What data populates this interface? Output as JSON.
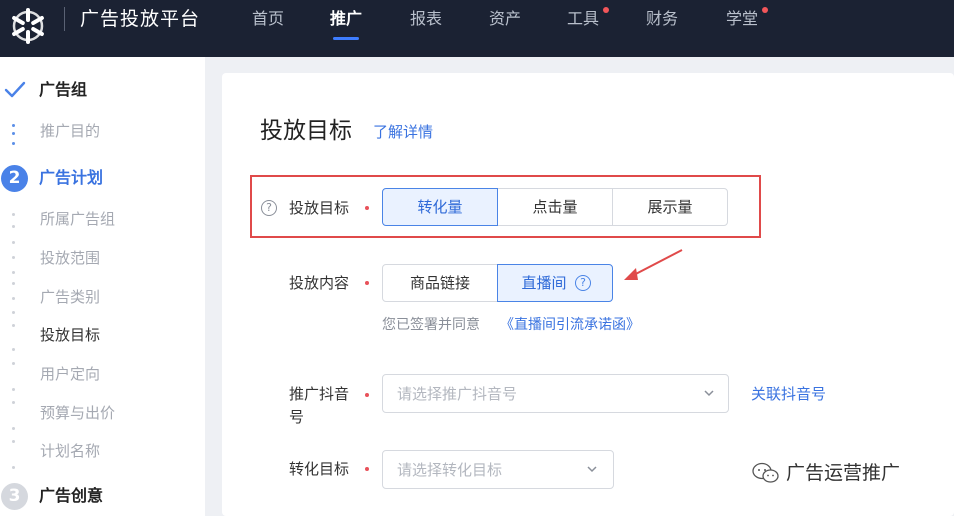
{
  "app": {
    "brand": "广告投放平台",
    "logo": "aperture-logo-icon"
  },
  "nav": {
    "items": [
      {
        "label": "首页",
        "active": false,
        "dot": false
      },
      {
        "label": "推广",
        "active": true,
        "dot": false
      },
      {
        "label": "报表",
        "active": false,
        "dot": false
      },
      {
        "label": "资产",
        "active": false,
        "dot": false
      },
      {
        "label": "工具",
        "active": false,
        "dot": true
      },
      {
        "label": "财务",
        "active": false,
        "dot": false
      },
      {
        "label": "学堂",
        "active": false,
        "dot": true
      }
    ]
  },
  "sidebar": {
    "step1": {
      "icon": "checkmark-icon",
      "title": "广告组",
      "items": [
        "推广目的"
      ]
    },
    "step2": {
      "number": "2",
      "title": "广告计划",
      "items": [
        "所属广告组",
        "投放范围",
        "广告类别",
        "投放目标",
        "用户定向",
        "预算与出价",
        "计划名称"
      ],
      "current": "投放目标"
    },
    "step3": {
      "number": "3",
      "title": "广告创意"
    }
  },
  "main": {
    "title": "投放目标",
    "learn_more": "了解详情",
    "goal": {
      "label": "投放目标",
      "options": [
        "转化量",
        "点击量",
        "展示量"
      ],
      "selected": "转化量"
    },
    "content": {
      "label": "投放内容",
      "options": [
        "商品链接",
        "直播间"
      ],
      "selected": "直播间"
    },
    "agreement": {
      "text": "您已签署并同意",
      "link": "《直播间引流承诺函》"
    },
    "douyin": {
      "label_line1": "推广抖音",
      "label_line2": "号",
      "placeholder": "请选择推广抖音号",
      "link": "关联抖音号"
    },
    "conversion": {
      "label": "转化目标",
      "placeholder": "请选择转化目标"
    }
  },
  "watermark": {
    "text": "广告运营推广",
    "icon": "wechat-icon"
  },
  "colors": {
    "accent": "#3a73e0",
    "highlight": "#e04a4a",
    "nav_bg": "#1b2233",
    "required": "#e8515a"
  }
}
